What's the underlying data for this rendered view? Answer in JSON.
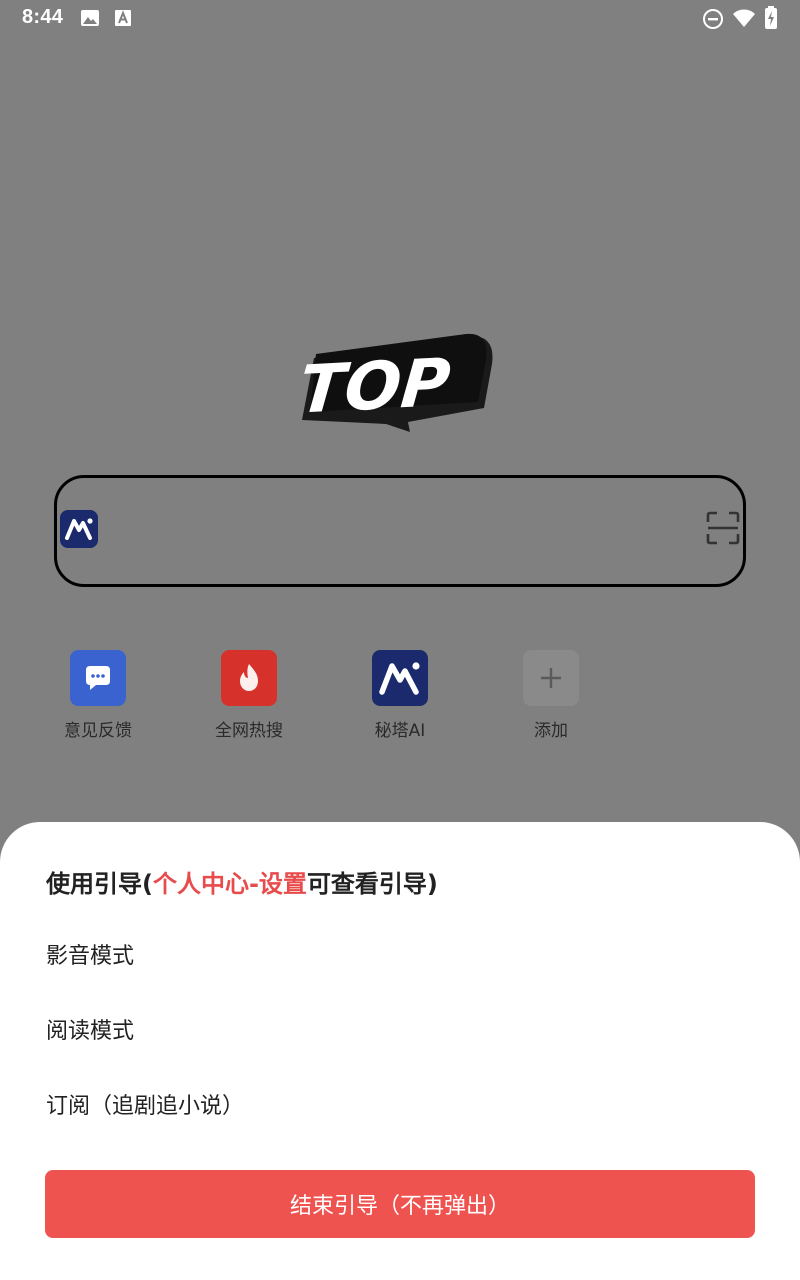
{
  "status_bar": {
    "time": "8:44",
    "left_icons": [
      "image-icon",
      "font-download-icon"
    ],
    "right_icons": [
      "do-not-disturb-icon",
      "wifi-icon",
      "battery-charging-icon"
    ]
  },
  "logo": {
    "text": "TOP"
  },
  "search": {
    "left_icon": "metaso-logo-icon",
    "right_icon": "scan-icon"
  },
  "shortcuts": [
    {
      "label": "意见反馈",
      "icon": "chat-bubble-icon",
      "color": "#3a63cf"
    },
    {
      "label": "全网热搜",
      "icon": "fire-icon",
      "color": "#d7312b"
    },
    {
      "label": "秘塔AI",
      "icon": "metaso-logo-icon",
      "color": "#1a2a6c"
    },
    {
      "label": "添加",
      "icon": "plus-icon",
      "color": "#8a8a8a"
    }
  ],
  "sheet": {
    "title_prefix": "使用引导(",
    "title_highlight": "个人中心-设置",
    "title_suffix": "可查看引导)",
    "items": [
      "影音模式",
      "阅读模式",
      "订阅（追剧追小说）"
    ],
    "end_button_label": "结束引导（不再弹出）"
  },
  "colors": {
    "overlay": "#808080",
    "accent_red": "#ef5350",
    "highlight_red": "#e84b4b"
  }
}
